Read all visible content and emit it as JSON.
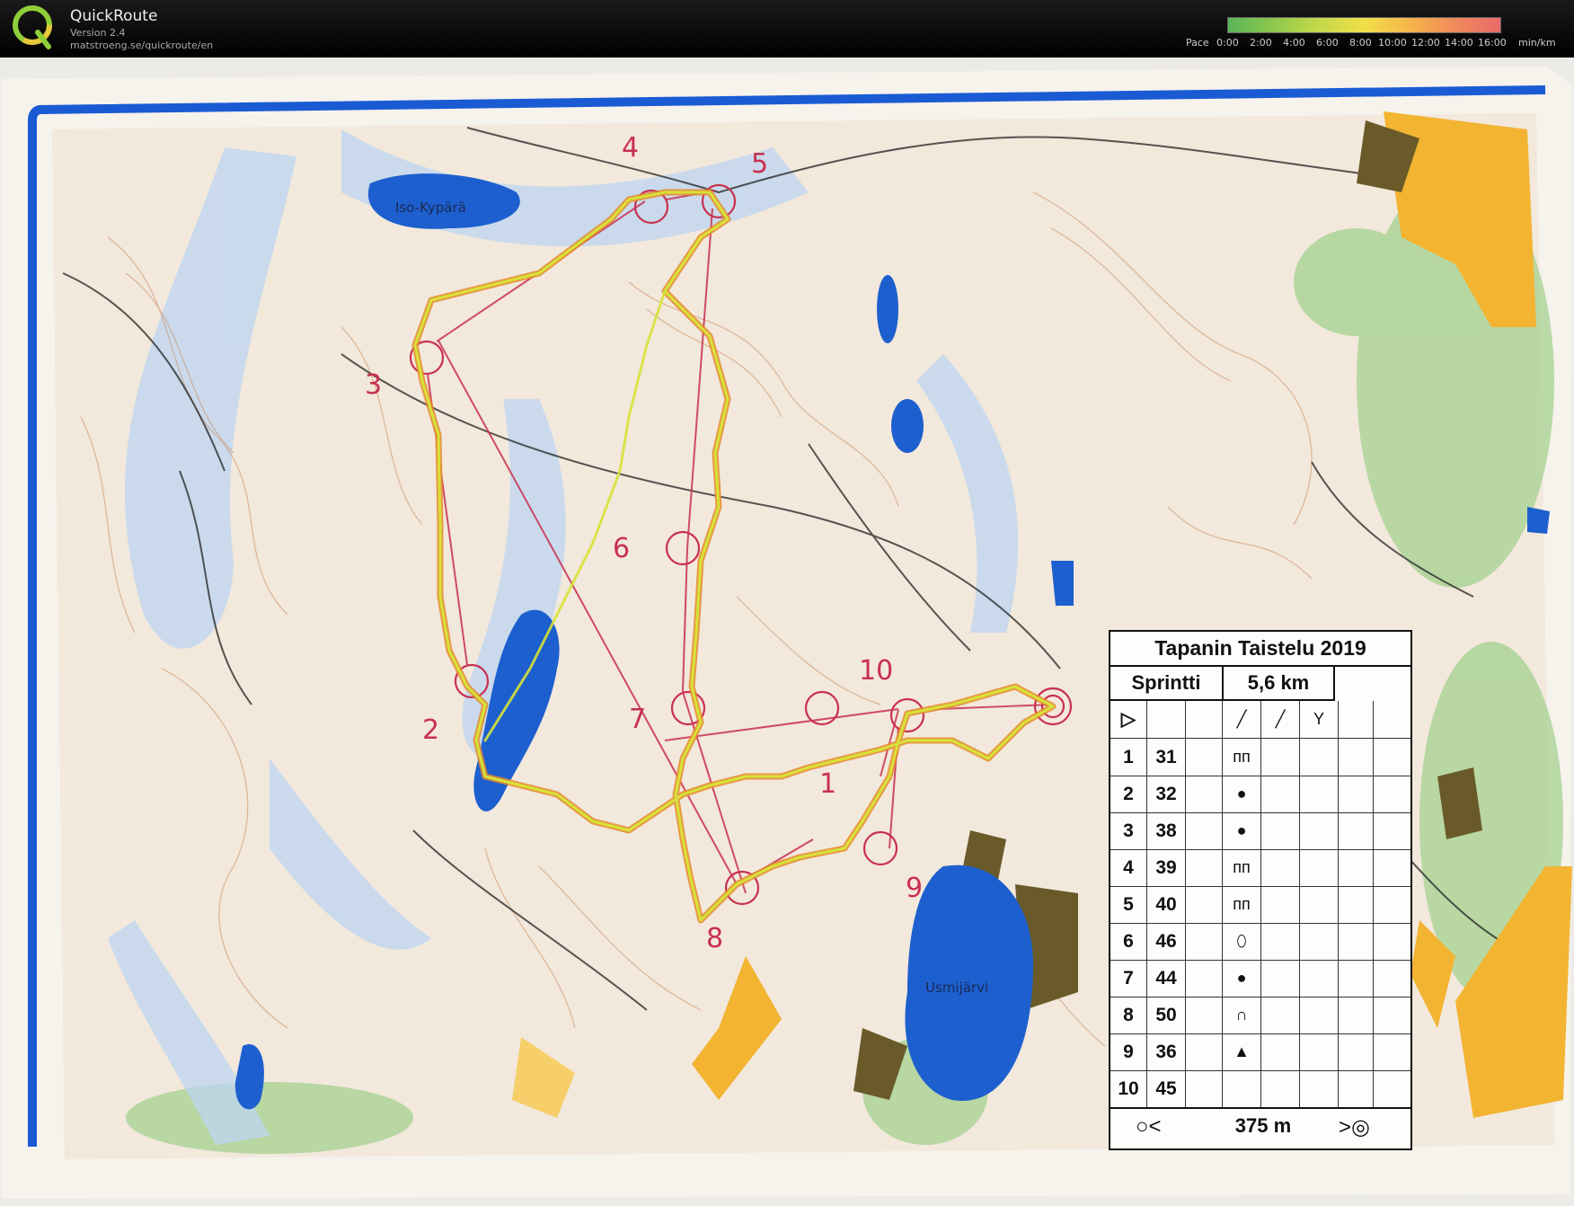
{
  "header": {
    "app_title": "QuickRoute",
    "version": "Version 2.4",
    "url": "matstroeng.se/quickroute/en",
    "pace_label": "Pace",
    "pace_ticks": [
      "0:00",
      "2:00",
      "4:00",
      "6:00",
      "8:00",
      "10:00",
      "12:00",
      "14:00",
      "16:00"
    ],
    "pace_unit": "min/km",
    "pace_colors": [
      "#5ab55a",
      "#8cc84b",
      "#c4d94a",
      "#f0e04a",
      "#f5b54a",
      "#f08a5a",
      "#e86a6a"
    ]
  },
  "map": {
    "lake_labels": [
      "Iso-Kypärä",
      "Usmijärvi"
    ],
    "control_numbers": [
      "1",
      "2",
      "3",
      "4",
      "5",
      "6",
      "7",
      "8",
      "9",
      "10"
    ],
    "colors": {
      "paper": "#f4efe7",
      "frame_blue": "#1a5bd4",
      "water": "#1d5fce",
      "course_purple": "#c8304f",
      "route_yellow": "#d7e238",
      "route_orange": "#e58a2a",
      "field_yellow": "#f2b431",
      "marsh": "#6a5a2a"
    }
  },
  "card": {
    "title": "Tapanin Taistelu 2019",
    "class": "Sprintti",
    "length": "5,6 km",
    "start_symbol": "▷",
    "rows": [
      {
        "num": "1",
        "code": "31",
        "sym": "ᴨᴨ"
      },
      {
        "num": "2",
        "code": "32",
        "sym": "●"
      },
      {
        "num": "3",
        "code": "38",
        "sym": "●"
      },
      {
        "num": "4",
        "code": "39",
        "sym": "ᴨᴨ"
      },
      {
        "num": "5",
        "code": "40",
        "sym": "ᴨᴨ"
      },
      {
        "num": "6",
        "code": "46",
        "sym": "⬯"
      },
      {
        "num": "7",
        "code": "44",
        "sym": "●"
      },
      {
        "num": "8",
        "code": "50",
        "sym": "∩"
      },
      {
        "num": "9",
        "code": "36",
        "sym": "▲"
      },
      {
        "num": "10",
        "code": "45",
        "sym": ""
      }
    ],
    "finish_distance": "375 m",
    "finish_left": "○<",
    "finish_right": ">◎"
  }
}
